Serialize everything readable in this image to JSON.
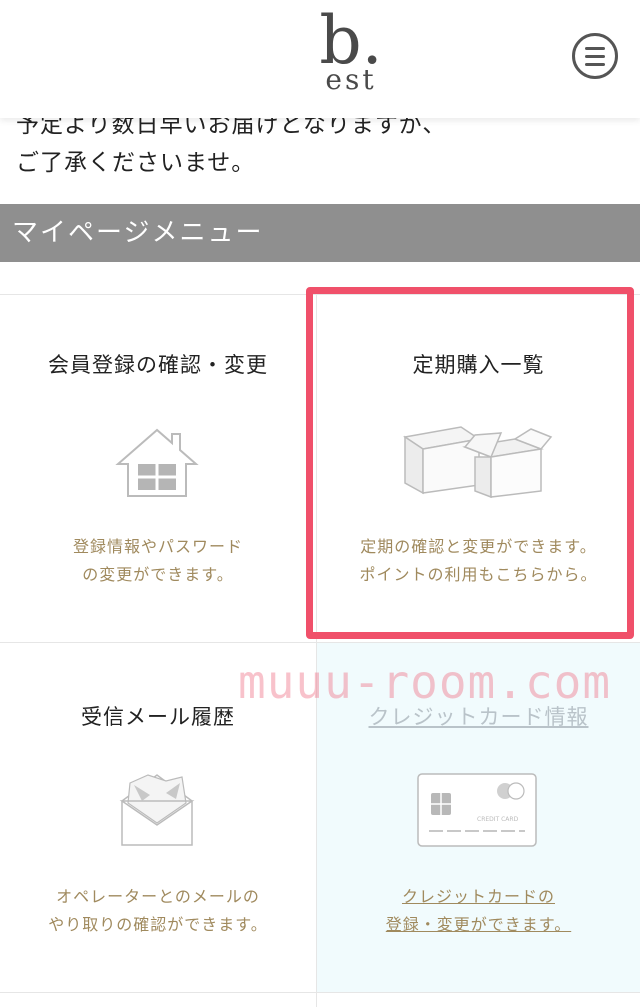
{
  "header": {
    "logo_main": "b.",
    "logo_sub": "est",
    "menu_label": "menu"
  },
  "notice": {
    "line1": "予定より数日早いお届けとなりますが、",
    "line2": "ご了承くださいませ。"
  },
  "mypage_menu": {
    "title": "マイページメニュー",
    "items": [
      {
        "title": "会員登録の確認・変更",
        "desc1": "登録情報やパスワード",
        "desc2": "の変更ができます。",
        "icon": "house-icon"
      },
      {
        "title": "定期購入一覧",
        "desc1": "定期の確認と変更ができます。",
        "desc2": "ポイントの利用もこちらから。",
        "icon": "boxes-icon"
      },
      {
        "title": "受信メール履歴",
        "desc1": "オペレーターとのメールの",
        "desc2": "やり取りの確認ができます。",
        "icon": "envelope-icon"
      },
      {
        "title": "クレジットカード情報",
        "desc1": "クレジットカードの",
        "desc2": "登録・変更ができます。",
        "icon": "credit-card-icon",
        "card_text": "CREDIT CARD"
      }
    ]
  },
  "watermark": "muuu-room.com",
  "colors": {
    "accent": "#f0506a",
    "desc": "#a08a5e",
    "menu_bar": "#8f8f8f"
  }
}
